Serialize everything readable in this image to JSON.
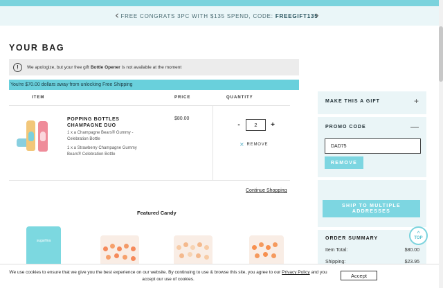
{
  "promo_bar": {
    "text": "FREE CONGRATS 3PC WITH $135 SPEND, CODE:",
    "code": "FREEGIFT135",
    "prev_icon": "chevron-left-icon",
    "next_icon": "chevron-right-icon"
  },
  "bag": {
    "title": "YOUR BAG",
    "notice_pre": "We apologize, but your free gift",
    "notice_item": "Bottle Opener",
    "notice_post": "is not available at the moment",
    "shipping_message": "You're $70.00 dollars away from unlocking Free Shipping",
    "columns": {
      "item": "ITEM",
      "price": "PRICE",
      "quantity": "QUANTITY"
    }
  },
  "line_item": {
    "name": "POPPING BOTTLES CHAMPAGNE DUO",
    "desc_1": "1 x a Champagne Bears® Gummy - Celebration Bottle",
    "desc_2": "1 x a Strawberry Champagne Gummy Bears® Celebration Bottle",
    "price": "$80.00",
    "quantity": "2",
    "minus": "-",
    "plus": "+",
    "remove_label": "REMOVE"
  },
  "continue_label": "Continue Shopping",
  "featured_title": "Featured Candy",
  "featured_bag_label": "sugarfina",
  "sidebar": {
    "gift_label": "MAKE THIS A GIFT",
    "gift_ctl": "+",
    "promo_label": "PROMO CODE",
    "promo_ctl": "—",
    "promo_value": "DAD75",
    "remove_button": "REMOVE",
    "ship_multiple": "SHIP TO MULTIPLE ADDRESSES",
    "summary_title": "ORDER SUMMARY",
    "item_total_label": "Item Total:",
    "item_total_value": "$80.00",
    "shipping_label": "Shipping:",
    "shipping_value": "$23.95"
  },
  "top_button": "TOP",
  "cookie": {
    "text_pre": "We use cookies to ensure that we give you the best experience on our website. By continuing to use & browse this site, you agree to our",
    "policy_link": "Privacy Policy",
    "text_post": "and you accept our use of cookies.",
    "accept_label": "Accept"
  },
  "colors": {
    "accent": "#7ad3dd",
    "shipping_bar": "#69d0dc",
    "sidebar_bg": "#eaf5f7"
  }
}
